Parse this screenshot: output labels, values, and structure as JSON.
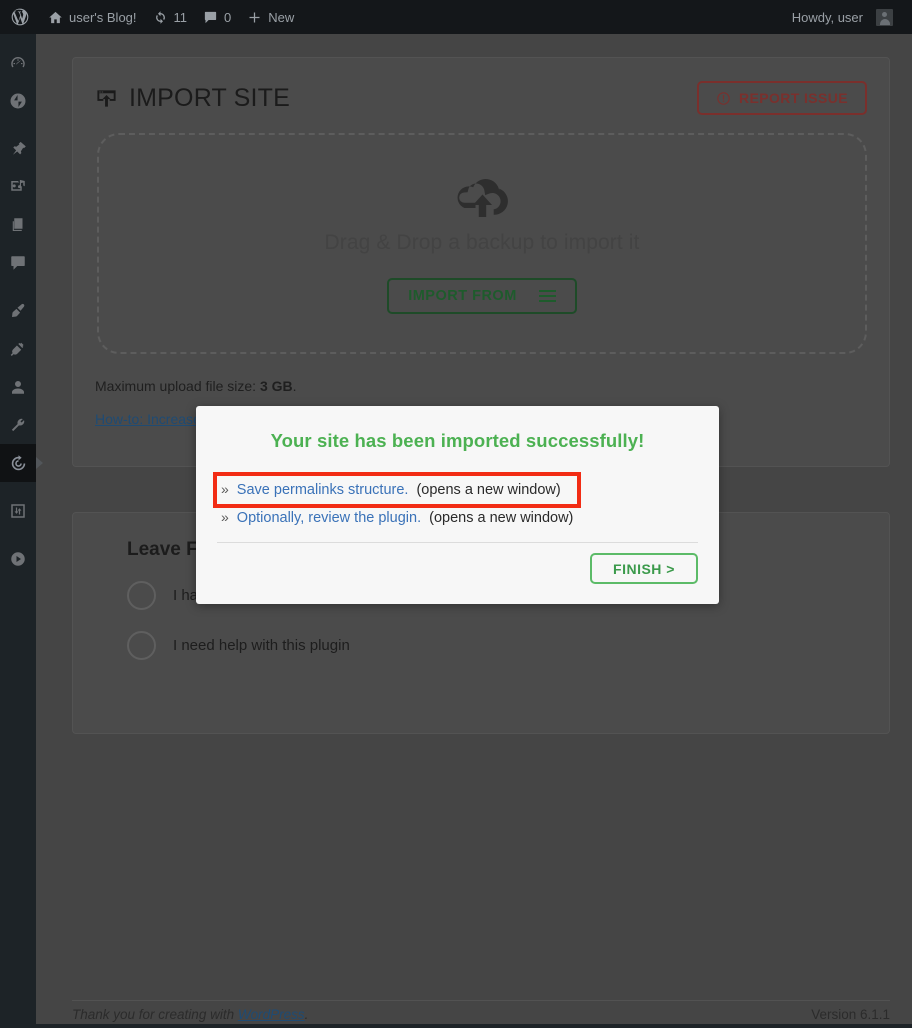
{
  "adminbar": {
    "logo_icon": "wordpress-logo-icon",
    "site": {
      "icon": "home-icon",
      "label": "user's Blog!"
    },
    "updates": {
      "icon": "updates-icon",
      "count": "11"
    },
    "comments": {
      "icon": "comment-bubble-icon",
      "count": "0"
    },
    "new": {
      "icon": "plus-icon",
      "label": "New"
    },
    "account": {
      "greeting": "Howdy, user",
      "avatar_icon": "user-avatar-icon"
    }
  },
  "sidebar": {
    "items": [
      {
        "name": "dashboard",
        "icon": "dashboard-icon",
        "current": false
      },
      {
        "name": "jetpack",
        "icon": "jetpack-icon",
        "current": false
      },
      {
        "name": "posts",
        "icon": "pin-icon",
        "current": false
      },
      {
        "name": "media",
        "icon": "media-icon",
        "current": false
      },
      {
        "name": "pages",
        "icon": "pages-icon",
        "current": false
      },
      {
        "name": "comments",
        "icon": "comment-bubble-icon",
        "current": false
      },
      {
        "name": "appearance",
        "icon": "paintbrush-icon",
        "current": false
      },
      {
        "name": "plugins",
        "icon": "plug-icon",
        "current": false
      },
      {
        "name": "users",
        "icon": "user-icon",
        "current": false
      },
      {
        "name": "tools",
        "icon": "wrench-icon",
        "current": false
      },
      {
        "name": "all-in-one-wp-migration",
        "icon": "migration-circle-icon",
        "current": true
      },
      {
        "name": "import-export",
        "icon": "sliders-icon",
        "current": false
      },
      {
        "name": "media-player",
        "icon": "play-circle-icon",
        "current": false
      }
    ]
  },
  "import_panel": {
    "title": "IMPORT SITE",
    "title_icon": "import-window-icon",
    "report_issue": {
      "label": "REPORT ISSUE",
      "icon": "warning-circle-icon"
    },
    "dropzone": {
      "icon": "cloud-upload-icon",
      "text": "Drag & Drop a backup to import it",
      "button_label": "IMPORT FROM",
      "button_icon": "hamburger-menu-icon"
    },
    "max_upload_prefix": "Maximum upload file size: ",
    "max_upload_value": "3 GB",
    "max_upload_suffix": ".",
    "howto_link": "How-to: Increase maximum upload file size"
  },
  "feedback_panel": {
    "title": "Leave Feedback",
    "options": [
      {
        "label": "I have ideas to improve this plugin",
        "selected": false
      },
      {
        "label": "I need help with this plugin",
        "selected": false
      }
    ]
  },
  "modal": {
    "heading": "Your site has been imported successfully!",
    "links": [
      {
        "bullet": "»",
        "link_text": "Save permalinks structure.",
        "note": "(opens a new window)",
        "highlighted": true
      },
      {
        "bullet": "»",
        "link_text": "Optionally, review the plugin.",
        "note": "(opens a new window)",
        "highlighted": false
      }
    ],
    "finish_label": "FINISH >"
  },
  "footer": {
    "thanks_prefix": "Thank you for creating with ",
    "thanks_link": "WordPress",
    "thanks_suffix": ".",
    "version": "Version 6.1.1"
  },
  "colors": {
    "accent_green": "#4cb152",
    "highlight_red": "#f22c14",
    "link_blue": "#3a72b8",
    "report_red": "#7a302d"
  }
}
